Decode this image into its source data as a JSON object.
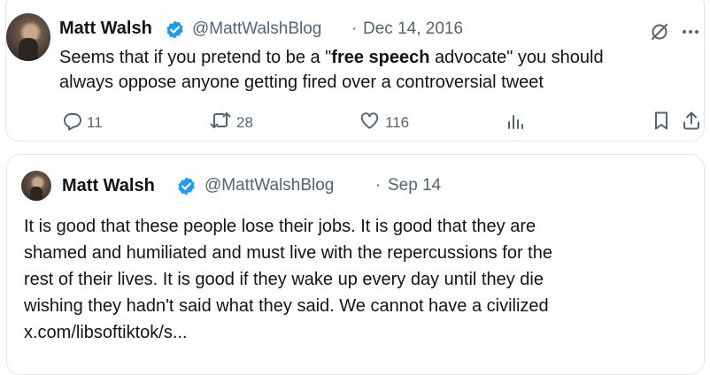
{
  "tweet": {
    "author_name": "Matt Walsh",
    "handle": "@MattWalshBlog",
    "separator": "·",
    "date": "Dec 14, 2016",
    "text_line1_before": "Seems that if you pretend to be a \"",
    "text_line1_bold": "free speech",
    "text_line1_after": " advocate\" you should",
    "text_line2": "always oppose anyone getting fired over a controversial tweet",
    "replies": "11",
    "reposts": "28",
    "likes": "116"
  },
  "quoted_tweet": {
    "author_name": "Matt Walsh",
    "handle": "@MattWalshBlog",
    "separator": "·",
    "date": "Sep 14",
    "lines": [
      "It is good that these people lose their jobs. It is good that they are",
      "shamed and humiliated and must live with the repercussions for the",
      "rest of their lives. It is good if they wake up every day until they die",
      "wishing they hadn't said what they said. We cannot have a civilized",
      "x.com/libsoftiktok/s..."
    ]
  },
  "colors": {
    "verified": "#1d9bf0",
    "muted": "#536471",
    "text": "#0f1419",
    "border": "#e3e6e8"
  },
  "icons": [
    "grok-icon",
    "more-icon",
    "reply-icon",
    "repost-icon",
    "like-icon",
    "views-icon",
    "bookmark-icon",
    "share-icon",
    "verified-badge-icon"
  ]
}
